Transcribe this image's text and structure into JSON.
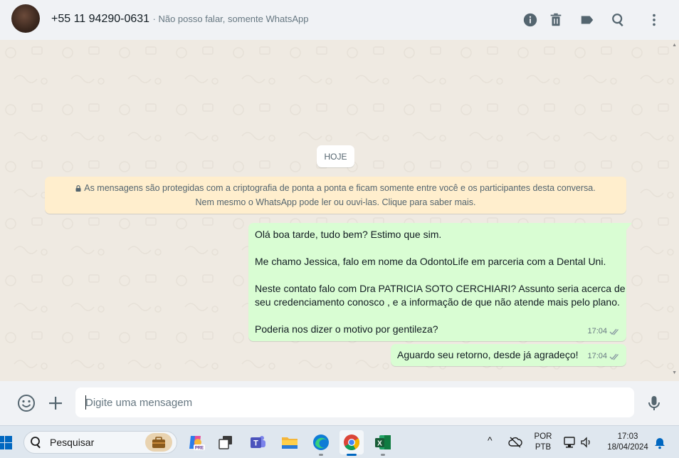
{
  "header": {
    "contact_name": "+55 11 94290-0631",
    "contact_status": "· Não posso falar, somente WhatsApp",
    "icons": [
      "info-icon",
      "trash-icon",
      "label-icon",
      "search-icon",
      "more-icon"
    ]
  },
  "chat": {
    "date_label": "HOJE",
    "encryption_notice": "As mensagens são protegidas com a criptografia de ponta a ponta e ficam somente entre você e os participantes desta conversa. Nem mesmo o WhatsApp pode ler ou ouvi-las. Clique para saber mais.",
    "messages": [
      {
        "lines": [
          "Olá boa tarde, tudo bem? Estimo que sim.",
          "",
          "Me chamo Jessica, falo em nome da OdontoLife em parceria com a Dental Uni.",
          "",
          "Neste contato falo com Dra PATRICIA SOTO CERCHIARI? Assunto seria acerca de",
          "seu credenciamento conosco , e a informação de que não atende mais pelo plano.",
          "",
          "Poderia nos dizer o motivo por gentileza?"
        ],
        "time": "17:04",
        "status": "read"
      },
      {
        "lines": [
          "Aguardo seu retorno, desde já agradeço!"
        ],
        "time": "17:04",
        "status": "read"
      }
    ]
  },
  "composer": {
    "placeholder": "Digite uma mensagem"
  },
  "taskbar": {
    "search_label": "Pesquisar",
    "copilot_badge": "PRE",
    "language_top": "POR",
    "language_bottom": "PTB",
    "clock_time": "17:03",
    "clock_date": "18/04/2024"
  },
  "colors": {
    "outgoing_bubble": "#d9fdd3",
    "chat_background": "#efeae2",
    "notice_background": "#ffeecd",
    "header_background": "#f0f2f5"
  }
}
